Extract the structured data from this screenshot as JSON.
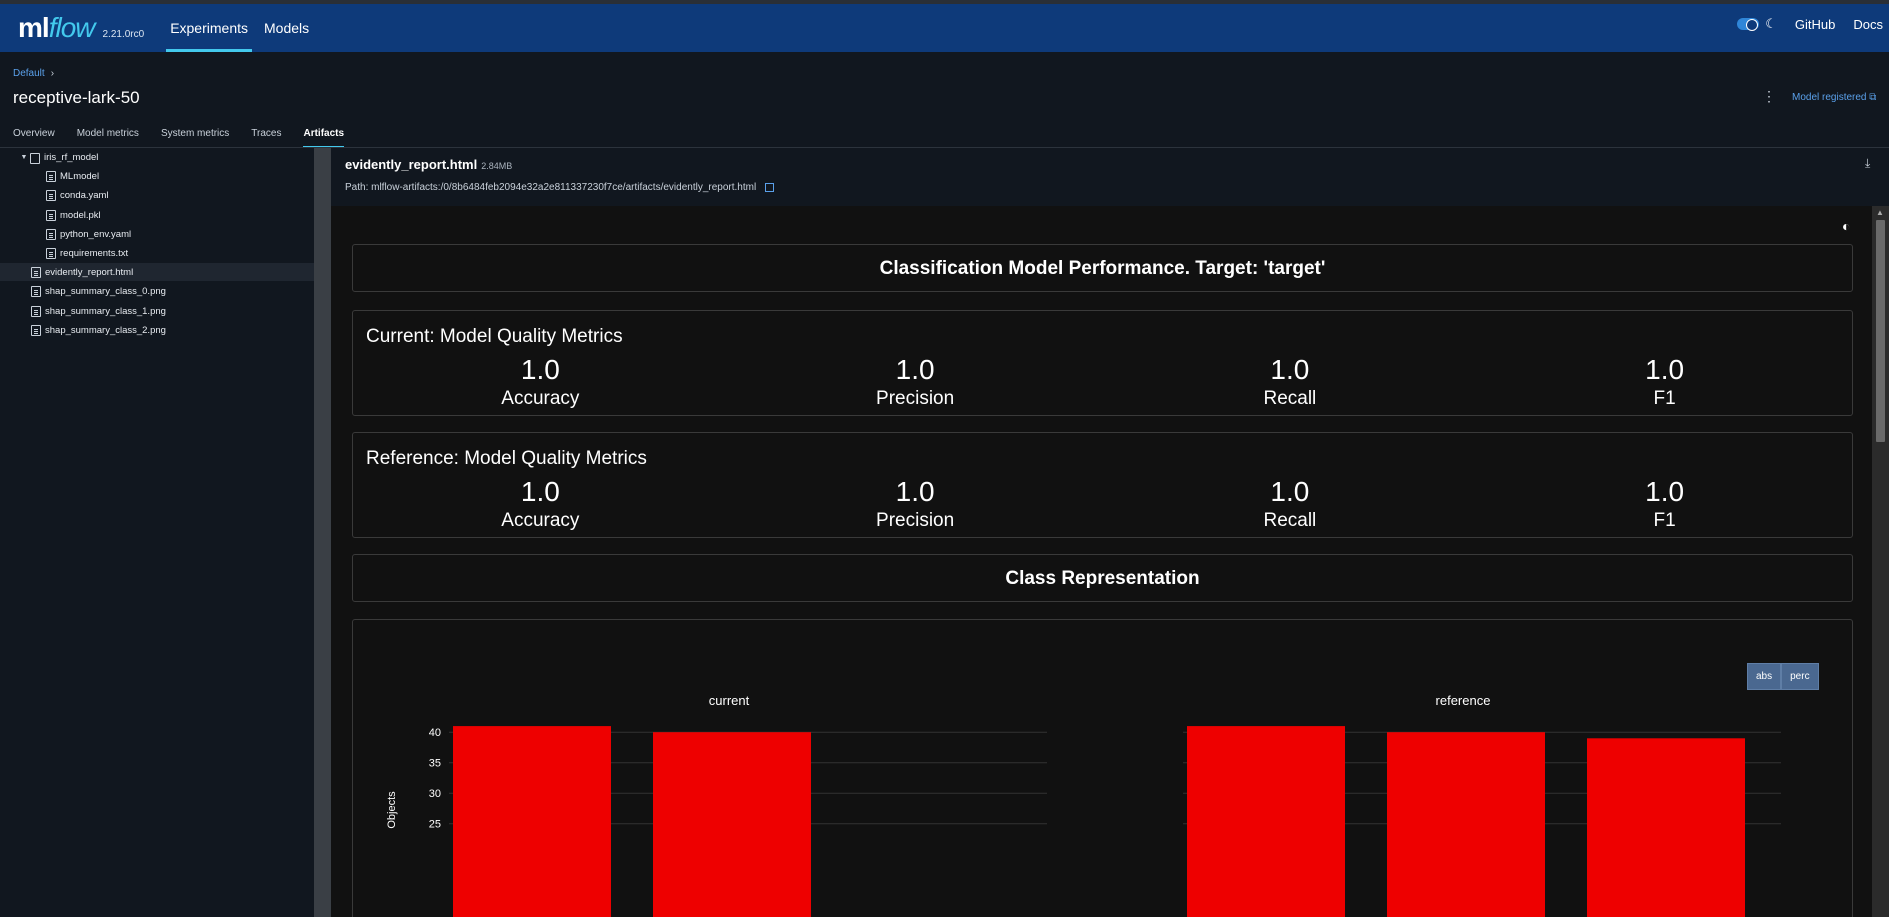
{
  "header": {
    "logo_ml": "ml",
    "logo_flow": "flow",
    "version": "2.21.0rc0",
    "nav": [
      "Experiments",
      "Models"
    ],
    "links": [
      "GitHub",
      "Docs"
    ],
    "moon": "☾"
  },
  "breadcrumb": {
    "parent": "Default",
    "sep": "›"
  },
  "run": {
    "title": "receptive-lark-50",
    "kebab": "⋮",
    "registered_label": "Model registered",
    "external_icon": "⧉"
  },
  "tabs": [
    "Overview",
    "Model metrics",
    "System metrics",
    "Traces",
    "Artifacts"
  ],
  "tree": [
    {
      "label": "iris_rf_model",
      "type": "folder"
    },
    {
      "label": "MLmodel",
      "type": "file"
    },
    {
      "label": "conda.yaml",
      "type": "file"
    },
    {
      "label": "model.pkl",
      "type": "file"
    },
    {
      "label": "python_env.yaml",
      "type": "file"
    },
    {
      "label": "requirements.txt",
      "type": "file"
    },
    {
      "label": "evidently_report.html",
      "type": "file",
      "selected": true
    },
    {
      "label": "shap_summary_class_0.png",
      "type": "file"
    },
    {
      "label": "shap_summary_class_1.png",
      "type": "file"
    },
    {
      "label": "shap_summary_class_2.png",
      "type": "file"
    }
  ],
  "viewer": {
    "file_name": "evidently_report.html",
    "file_size": "2.84MB",
    "path": "Path: mlflow-artifacts:/0/8b6484feb2094e32a2e811337230f7ce/artifacts/evidently_report.html",
    "download_icon": "⤓"
  },
  "report": {
    "theme_icon": "◐",
    "title": "Classification Model Performance. Target: 'target'",
    "current_head": "Current: Model Quality Metrics",
    "reference_head": "Reference: Model Quality Metrics",
    "current_metrics": [
      {
        "value": "1.0",
        "label": "Accuracy"
      },
      {
        "value": "1.0",
        "label": "Precision"
      },
      {
        "value": "1.0",
        "label": "Recall"
      },
      {
        "value": "1.0",
        "label": "F1"
      }
    ],
    "reference_metrics": [
      {
        "value": "1.0",
        "label": "Accuracy"
      },
      {
        "value": "1.0",
        "label": "Precision"
      },
      {
        "value": "1.0",
        "label": "Recall"
      },
      {
        "value": "1.0",
        "label": "F1"
      }
    ],
    "class_title": "Class Representation",
    "buttons": [
      "abs",
      "perc"
    ]
  },
  "chart_data": [
    {
      "type": "bar",
      "title": "current",
      "xlabel": "",
      "ylabel": "Objects",
      "y_ticks": [
        25,
        30,
        35,
        40
      ],
      "ylim": [
        22,
        42
      ],
      "values": [
        41,
        40
      ],
      "bar_color": "#ee0000"
    },
    {
      "type": "bar",
      "title": "reference",
      "xlabel": "",
      "ylabel": "",
      "ylim": [
        22,
        42
      ],
      "values": [
        41,
        40,
        39
      ],
      "bar_color": "#ee0000"
    }
  ]
}
